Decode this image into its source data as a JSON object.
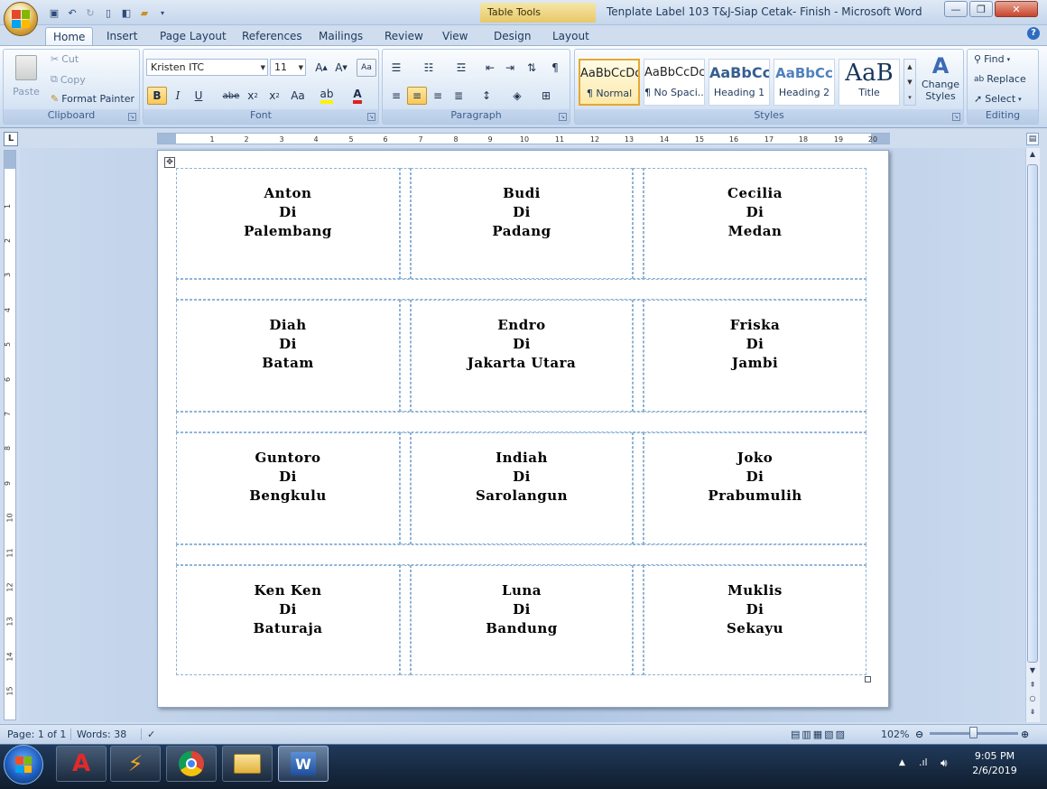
{
  "titlebar": {
    "contextual_tab": "Table Tools",
    "window_title": "Tenplate Label 103 T&J-Siap Cetak- Finish - Microsoft Word",
    "minimize": "—",
    "restore": "❐",
    "close": "✕"
  },
  "tabs": [
    "Home",
    "Insert",
    "Page Layout",
    "References",
    "Mailings",
    "Review",
    "View",
    "Design",
    "Layout"
  ],
  "ribbon": {
    "clipboard": {
      "label": "Clipboard",
      "paste": "Paste",
      "cut": "Cut",
      "copy": "Copy",
      "format_painter": "Format Painter"
    },
    "font": {
      "label": "Font",
      "family": "Kristen ITC",
      "size": "11"
    },
    "paragraph": {
      "label": "Paragraph"
    },
    "styles": {
      "label": "Styles",
      "items": [
        {
          "preview": "AaBbCcDc",
          "name": "¶ Normal"
        },
        {
          "preview": "AaBbCcDc",
          "name": "¶ No Spaci..."
        },
        {
          "preview": "AaBbCc",
          "name": "Heading 1"
        },
        {
          "preview": "AaBbCc",
          "name": "Heading 2"
        },
        {
          "preview": "AaB",
          "name": "Title"
        }
      ],
      "change_styles": "Change Styles"
    },
    "editing": {
      "label": "Editing",
      "find": "Find",
      "replace": "Replace",
      "select": "Select"
    }
  },
  "labels": [
    [
      "Anton",
      "Di",
      "Palembang"
    ],
    [
      "Budi",
      "Di",
      "Padang"
    ],
    [
      "Cecilia",
      "Di",
      "Medan"
    ],
    [
      "Diah",
      "Di",
      "Batam"
    ],
    [
      "Endro",
      "Di",
      "Jakarta Utara"
    ],
    [
      "Friska",
      "Di",
      "Jambi"
    ],
    [
      "Guntoro",
      "Di",
      "Bengkulu"
    ],
    [
      "Indiah",
      "Di",
      "Sarolangun"
    ],
    [
      "Joko",
      "Di",
      "Prabumulih"
    ],
    [
      "Ken Ken",
      "Di",
      "Baturaja"
    ],
    [
      "Luna",
      "Di",
      "Bandung"
    ],
    [
      "Muklis",
      "Di",
      "Sekayu"
    ]
  ],
  "ruler": {
    "h_ticks": [
      "1",
      "2",
      "3",
      "4",
      "5",
      "6",
      "7",
      "8",
      "9",
      "10",
      "11",
      "12",
      "13",
      "14",
      "15",
      "16",
      "17",
      "18",
      "19",
      "20"
    ],
    "v_ticks": [
      "1",
      "2",
      "3",
      "4",
      "5",
      "6",
      "7",
      "8",
      "9",
      "10",
      "11",
      "12",
      "13",
      "14",
      "15"
    ]
  },
  "status": {
    "page": "Page: 1 of 1",
    "words": "Words: 38",
    "zoom": "102%"
  },
  "clock": {
    "time": "9:05 PM",
    "date": "2/6/2019"
  }
}
